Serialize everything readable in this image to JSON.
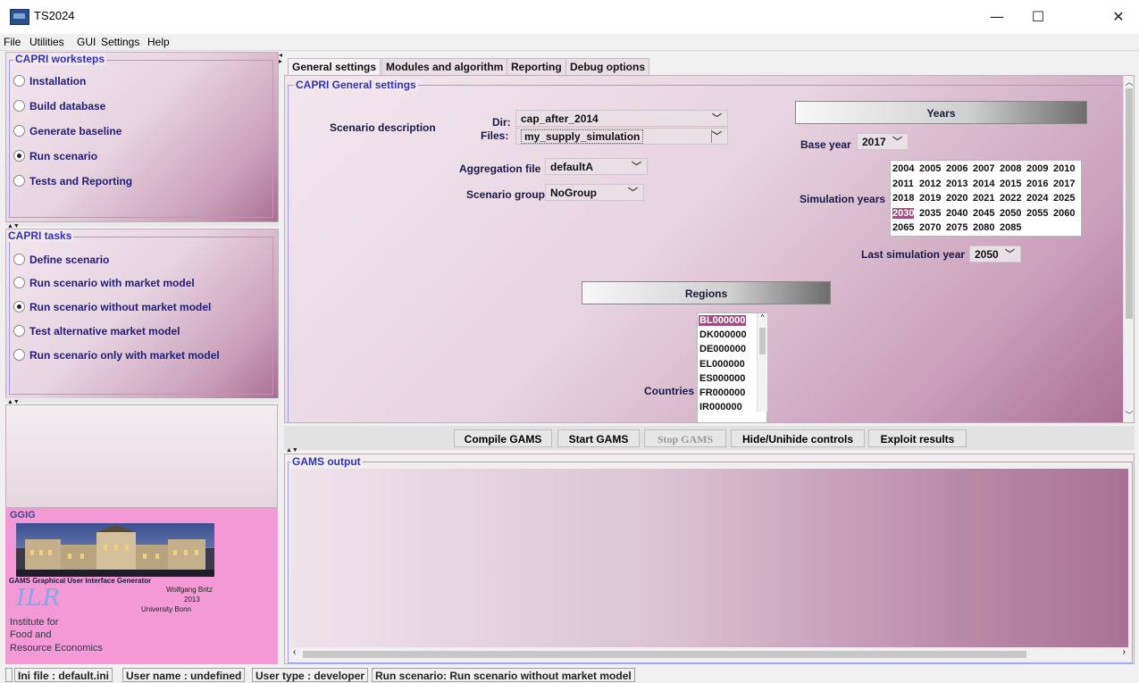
{
  "window": {
    "title": "TS2024",
    "minimize": "—",
    "maximize": "☐",
    "close": "✕"
  },
  "menu": [
    "File",
    "Utilities",
    "GUI",
    "Settings",
    "Help"
  ],
  "worksteps": {
    "title": "CAPRI worksteps",
    "items": [
      {
        "label": "Installation",
        "selected": false
      },
      {
        "label": "Build database",
        "selected": false
      },
      {
        "label": "Generate baseline",
        "selected": false
      },
      {
        "label": "Run scenario",
        "selected": true
      },
      {
        "label": "Tests and Reporting",
        "selected": false
      }
    ]
  },
  "tasks": {
    "title": "CAPRI tasks",
    "items": [
      {
        "label": "Define scenario",
        "selected": false
      },
      {
        "label": "Run scenario with market model",
        "selected": false
      },
      {
        "label": "Run scenario without market model",
        "selected": true
      },
      {
        "label": "Test alternative market model",
        "selected": false
      },
      {
        "label": "Run scenario only with market model",
        "selected": false
      }
    ]
  },
  "logo": {
    "group": "GGIG",
    "line1": "GAMS Graphical User Interface Generator",
    "author": "Wolfgang Britz",
    "year": "2013",
    "uni": "University Bonn",
    "ilr": "ILR",
    "inst1": "Institute  for",
    "inst2": "Food and",
    "inst3": "Resource Economics"
  },
  "tabs": [
    "General settings",
    "Modules and algorithm",
    "Reporting",
    "Debug options"
  ],
  "general": {
    "group_title": "CAPRI General settings",
    "scenario_description": "Scenario description",
    "dir_label": "Dir:",
    "dir_value": "cap_after_2014",
    "files_label": "Files:",
    "files_value": "my_supply_simulation",
    "aggregation_label": "Aggregation file",
    "aggregation_value": "defaultA",
    "scenario_group_label": "Scenario group",
    "scenario_group_value": "NoGroup",
    "years_header": "Years",
    "base_year_label": "Base year",
    "base_year_value": "2017",
    "simulation_years_label": "Simulation years",
    "simulation_years": [
      [
        "2004",
        "2005",
        "2006",
        "2007",
        "2008",
        "2009",
        "2010"
      ],
      [
        "2011",
        "2012",
        "2013",
        "2014",
        "2015",
        "2016",
        "2017"
      ],
      [
        "2018",
        "2019",
        "2020",
        "2021",
        "2022",
        "2024",
        "2025"
      ],
      [
        "2030",
        "2035",
        "2040",
        "2045",
        "2050",
        "2055",
        "2060"
      ],
      [
        "2065",
        "2070",
        "2075",
        "2080",
        "2085"
      ]
    ],
    "selected_year": "2030",
    "last_sim_year_label": "Last simulation year",
    "last_sim_year_value": "2050",
    "regions_header": "Regions",
    "countries_label": "Countries",
    "countries": [
      "BL000000",
      "DK000000",
      "DE000000",
      "EL000000",
      "ES000000",
      "FR000000",
      "IR000000"
    ],
    "selected_country": "BL000000"
  },
  "buttons": {
    "compile": "Compile GAMS",
    "start": "Start GAMS",
    "stop": "Stop GAMS",
    "hide": "Hide/Unihide controls",
    "exploit": "Exploit results"
  },
  "output": {
    "title": "GAMS output"
  },
  "status": {
    "ini": "Ini file : default.ini",
    "user": "User name : undefined",
    "type": "User type : developer",
    "task": "Run scenario: Run scenario without market model"
  },
  "colors": {
    "panel_accent": "#a96e91",
    "group_border": "#9aa0e6",
    "selection": "#9c4f80",
    "logo_bg": "#f39ad6"
  }
}
